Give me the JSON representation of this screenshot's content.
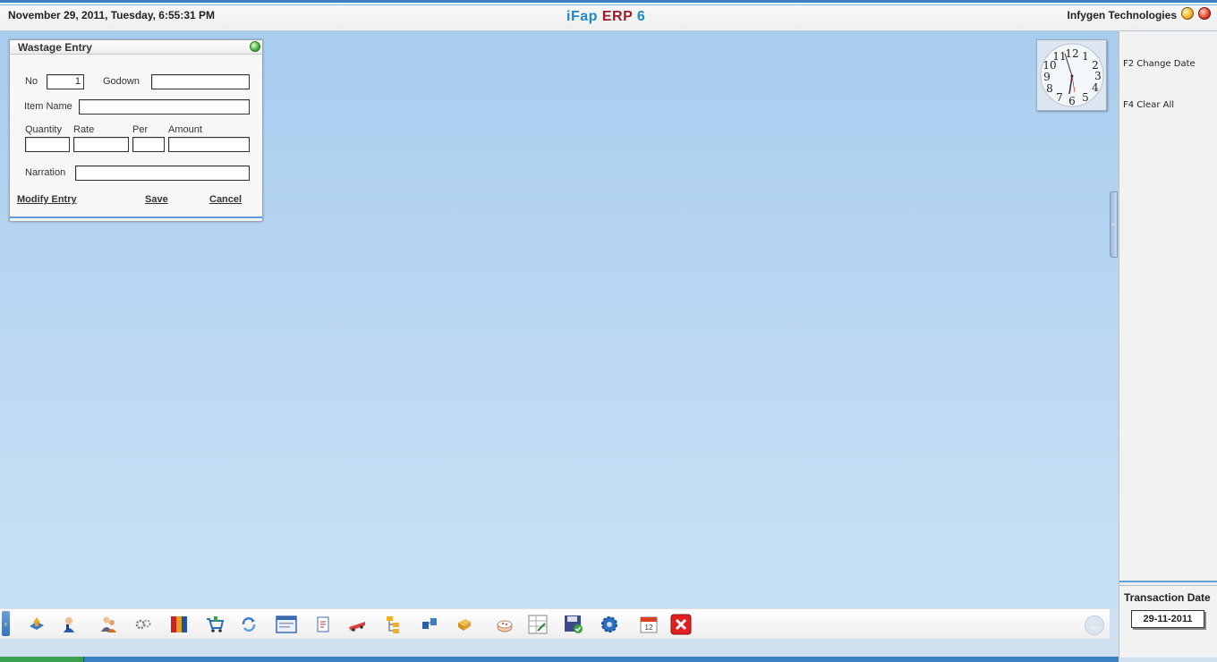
{
  "header": {
    "datetime": "November  29, 2011, Tuesday, 6:55:31 PM",
    "app_title_part1": "iFap",
    "app_title_part2": "ERP",
    "app_title_part3": "6",
    "company": "Infygen Technologies"
  },
  "dialog": {
    "title": "Wastage Entry",
    "no_label": "No",
    "no_value": "1",
    "godown_label": "Godown",
    "godown_value": "",
    "item_name_label": "Item Name",
    "item_name_value": "",
    "quantity_label": "Quantity",
    "rate_label": "Rate",
    "per_label": "Per",
    "amount_label": "Amount",
    "narration_label": "Narration",
    "modify_entry_first": "M",
    "modify_entry_rest": "odify Entry",
    "save_label": "Save",
    "cancel_label": "Cancel"
  },
  "right_panel": {
    "f2_label": "F2 Change Date",
    "f4_label": "F4 Clear All",
    "transaction_date_label": "Transaction Date",
    "transaction_date_value": "29-11-2011"
  },
  "clock": {
    "time": "6:55"
  },
  "taskbar": {
    "icons": [
      "cash-book-icon",
      "user-support-icon",
      "users-icon",
      "settings-gears-icon",
      "file-cabinet-icon",
      "shopping-cart-icon",
      "refresh-icon",
      "window-icon",
      "document-icon",
      "delivery-truck-icon",
      "folder-tree-icon",
      "transfer-icon",
      "box-icon",
      "cake-icon",
      "spreadsheet-icon",
      "save-disk-icon",
      "gear-icon",
      "calendar-icon",
      "close-icon"
    ],
    "accent_color": "#3d7fc4"
  }
}
